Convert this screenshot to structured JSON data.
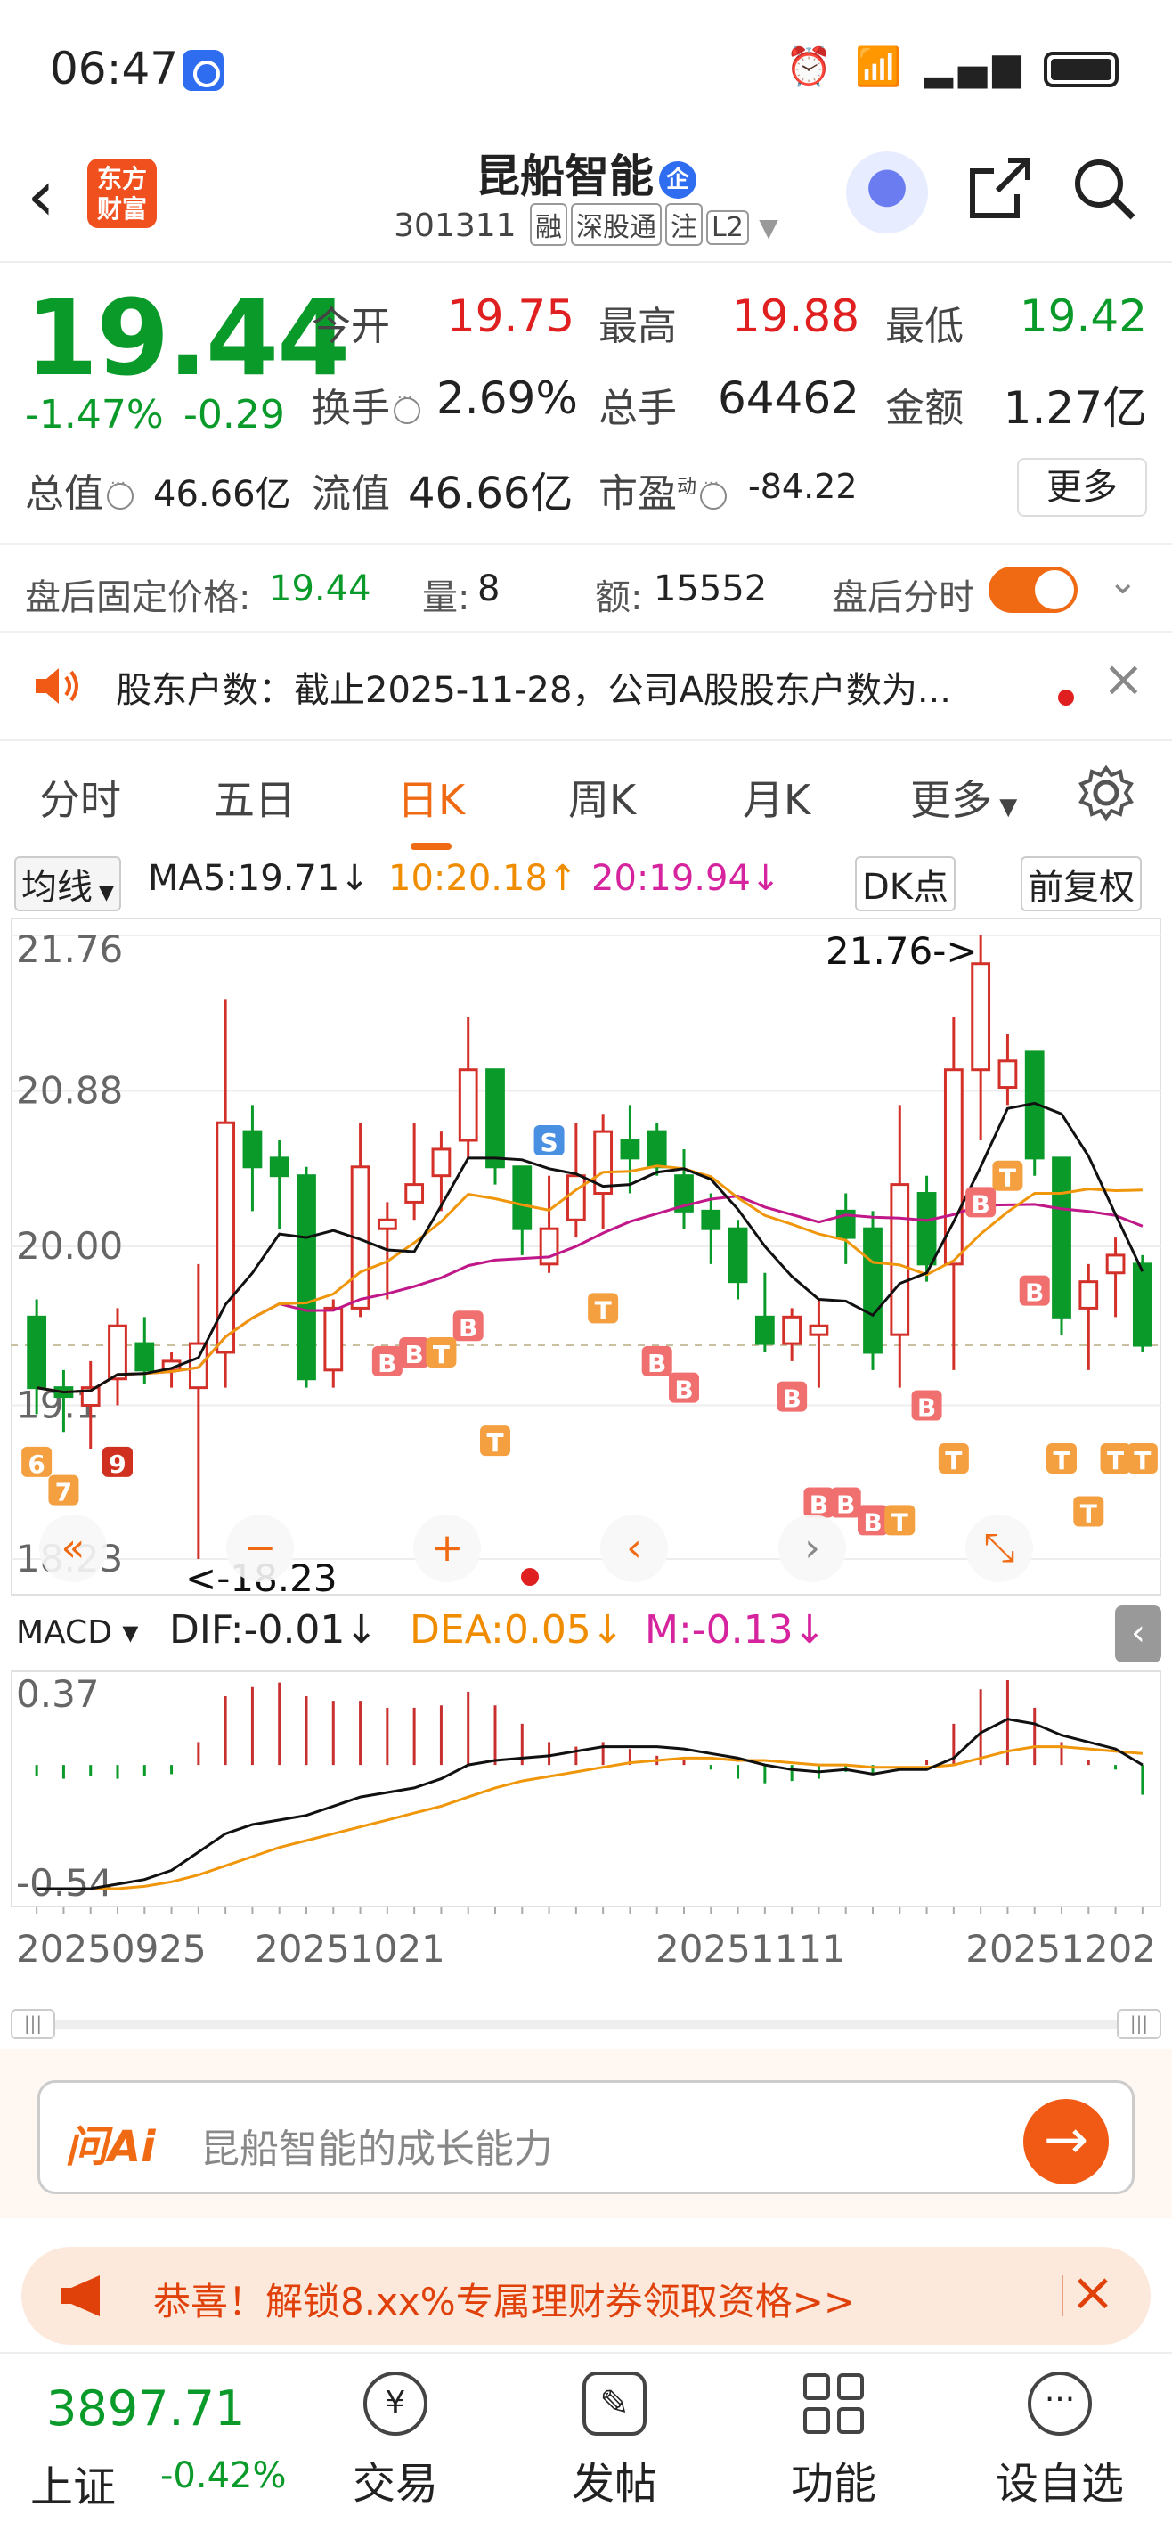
{
  "status_bar": {
    "time": "06:47",
    "network": "6 4G"
  },
  "header": {
    "brand_line1": "东方",
    "brand_line2": "财富",
    "stock_name": "昆船智能",
    "name_badge": "企",
    "code": "301311",
    "tags": [
      "融",
      "深股通",
      "注",
      "L2"
    ]
  },
  "quote": {
    "price": "19.44",
    "change_pct": "-1.47%",
    "change_amt": "-0.29",
    "open_label": "今开",
    "open": "19.75",
    "high_label": "最高",
    "high": "19.88",
    "low_label": "最低",
    "low": "19.42",
    "turnover_label": "换手",
    "turnover": "2.69%",
    "volume_label": "总手",
    "volume": "64462",
    "amount_label": "金额",
    "amount": "1.27亿",
    "mktcap_label": "总值",
    "mktcap": "46.66亿",
    "float_label": "流值",
    "float_cap": "46.66亿",
    "pe_label": "市盈",
    "pe_sup": "动",
    "pe": "-84.22",
    "more": "更多"
  },
  "after_hours": {
    "price_label": "盘后固定价格:",
    "price": "19.44",
    "vol_label": "量:",
    "vol": "8",
    "amt_label": "额:",
    "amt": "15552",
    "toggle_label": "盘后分时"
  },
  "notice": {
    "text": "股东户数：截止2025-11-28，公司A股股东户数为..."
  },
  "tabs": [
    {
      "label": "分时"
    },
    {
      "label": "五日"
    },
    {
      "label": "日K",
      "active": true
    },
    {
      "label": "周K"
    },
    {
      "label": "月K"
    },
    {
      "label": "更多"
    }
  ],
  "ma_line": {
    "selector": "均线",
    "ma5": "MA5:19.71↓",
    "ma10": "10:20.18↑",
    "ma20": "20:19.94↓",
    "dk": "DK点",
    "adjust": "前复权"
  },
  "chart_data": {
    "type": "candlestick",
    "price_ticks": [
      "21.76",
      "20.88",
      "20.00",
      "19.1",
      "18.23"
    ],
    "high_marker": "21.76->",
    "low_marker": "<-18.23",
    "candles": [
      {
        "o": 19.6,
        "h": 19.7,
        "l": 19.05,
        "c": 19.2
      },
      {
        "o": 19.2,
        "h": 19.3,
        "l": 18.95,
        "c": 19.15
      },
      {
        "o": 19.1,
        "h": 19.35,
        "l": 18.85,
        "c": 19.2
      },
      {
        "o": 19.25,
        "h": 19.65,
        "l": 19.1,
        "c": 19.55
      },
      {
        "o": 19.45,
        "h": 19.6,
        "l": 19.22,
        "c": 19.3
      },
      {
        "o": 19.3,
        "h": 19.4,
        "l": 19.2,
        "c": 19.35
      },
      {
        "o": 19.2,
        "h": 19.9,
        "l": 18.23,
        "c": 19.45
      },
      {
        "o": 19.4,
        "h": 21.4,
        "l": 19.2,
        "c": 20.7
      },
      {
        "o": 20.65,
        "h": 20.8,
        "l": 20.2,
        "c": 20.45
      },
      {
        "o": 20.5,
        "h": 20.6,
        "l": 20.1,
        "c": 20.4
      },
      {
        "o": 20.4,
        "h": 20.45,
        "l": 19.2,
        "c": 19.25
      },
      {
        "o": 19.3,
        "h": 19.7,
        "l": 19.2,
        "c": 19.65
      },
      {
        "o": 19.65,
        "h": 20.7,
        "l": 19.6,
        "c": 20.45
      },
      {
        "o": 20.1,
        "h": 20.25,
        "l": 19.7,
        "c": 20.15
      },
      {
        "o": 20.25,
        "h": 20.7,
        "l": 20.15,
        "c": 20.35
      },
      {
        "o": 20.4,
        "h": 20.65,
        "l": 20.2,
        "c": 20.55
      },
      {
        "o": 20.6,
        "h": 21.3,
        "l": 20.5,
        "c": 21.0
      },
      {
        "o": 21.0,
        "h": 21.0,
        "l": 20.35,
        "c": 20.45
      },
      {
        "o": 20.45,
        "h": 20.45,
        "l": 19.95,
        "c": 20.1
      },
      {
        "o": 19.9,
        "h": 20.4,
        "l": 19.85,
        "c": 20.1
      },
      {
        "o": 20.15,
        "h": 20.7,
        "l": 20.05,
        "c": 20.4
      },
      {
        "o": 20.3,
        "h": 20.75,
        "l": 20.1,
        "c": 20.65
      },
      {
        "o": 20.6,
        "h": 20.8,
        "l": 20.3,
        "c": 20.5
      },
      {
        "o": 20.65,
        "h": 20.7,
        "l": 20.4,
        "c": 20.45
      },
      {
        "o": 20.4,
        "h": 20.55,
        "l": 20.1,
        "c": 20.2
      },
      {
        "o": 20.2,
        "h": 20.3,
        "l": 19.9,
        "c": 20.1
      },
      {
        "o": 20.1,
        "h": 20.15,
        "l": 19.7,
        "c": 19.8
      },
      {
        "o": 19.6,
        "h": 19.85,
        "l": 19.4,
        "c": 19.45
      },
      {
        "o": 19.45,
        "h": 19.65,
        "l": 19.35,
        "c": 19.6
      },
      {
        "o": 19.5,
        "h": 19.7,
        "l": 19.2,
        "c": 19.55
      },
      {
        "o": 20.2,
        "h": 20.3,
        "l": 19.9,
        "c": 20.05
      },
      {
        "o": 20.1,
        "h": 20.2,
        "l": 19.3,
        "c": 19.4
      },
      {
        "o": 19.5,
        "h": 20.8,
        "l": 19.2,
        "c": 20.35
      },
      {
        "o": 20.3,
        "h": 20.4,
        "l": 19.8,
        "c": 19.9
      },
      {
        "o": 19.9,
        "h": 21.3,
        "l": 19.3,
        "c": 21.0
      },
      {
        "o": 21.0,
        "h": 21.76,
        "l": 20.6,
        "c": 21.6
      },
      {
        "o": 20.9,
        "h": 21.2,
        "l": 20.8,
        "c": 21.05
      },
      {
        "o": 21.1,
        "h": 21.1,
        "l": 20.4,
        "c": 20.5
      },
      {
        "o": 20.5,
        "h": 20.5,
        "l": 19.5,
        "c": 19.6
      },
      {
        "o": 19.65,
        "h": 19.9,
        "l": 19.3,
        "c": 19.8
      },
      {
        "o": 19.85,
        "h": 20.05,
        "l": 19.6,
        "c": 19.95
      },
      {
        "o": 19.9,
        "h": 19.95,
        "l": 19.4,
        "c": 19.44
      }
    ],
    "signal_labels": [
      "S",
      "B",
      "T",
      "6",
      "7",
      "9"
    ],
    "macd_label": "MACD",
    "dif": "DIF:-0.01↓",
    "dea": "DEA:0.05↓",
    "m": "M:-0.13↓",
    "macd_ticks": [
      "0.37",
      "-0.54"
    ],
    "dates": [
      "20250925",
      "20251021",
      "20251111",
      "20251202"
    ]
  },
  "ai": {
    "logo": "问Ai",
    "placeholder": "昆船智能的成长能力"
  },
  "promo": {
    "text": "恭喜！解锁8.xx%专属理财券领取资格>>"
  },
  "bottom": {
    "index_value": "3897.71",
    "index_name": "上证",
    "index_change": "-0.42%",
    "nav": [
      {
        "label": "交易",
        "icon": "trade-icon"
      },
      {
        "label": "发帖",
        "icon": "post-icon"
      },
      {
        "label": "功能",
        "icon": "grid-icon"
      },
      {
        "label": "设自选",
        "icon": "more-icon"
      }
    ]
  }
}
